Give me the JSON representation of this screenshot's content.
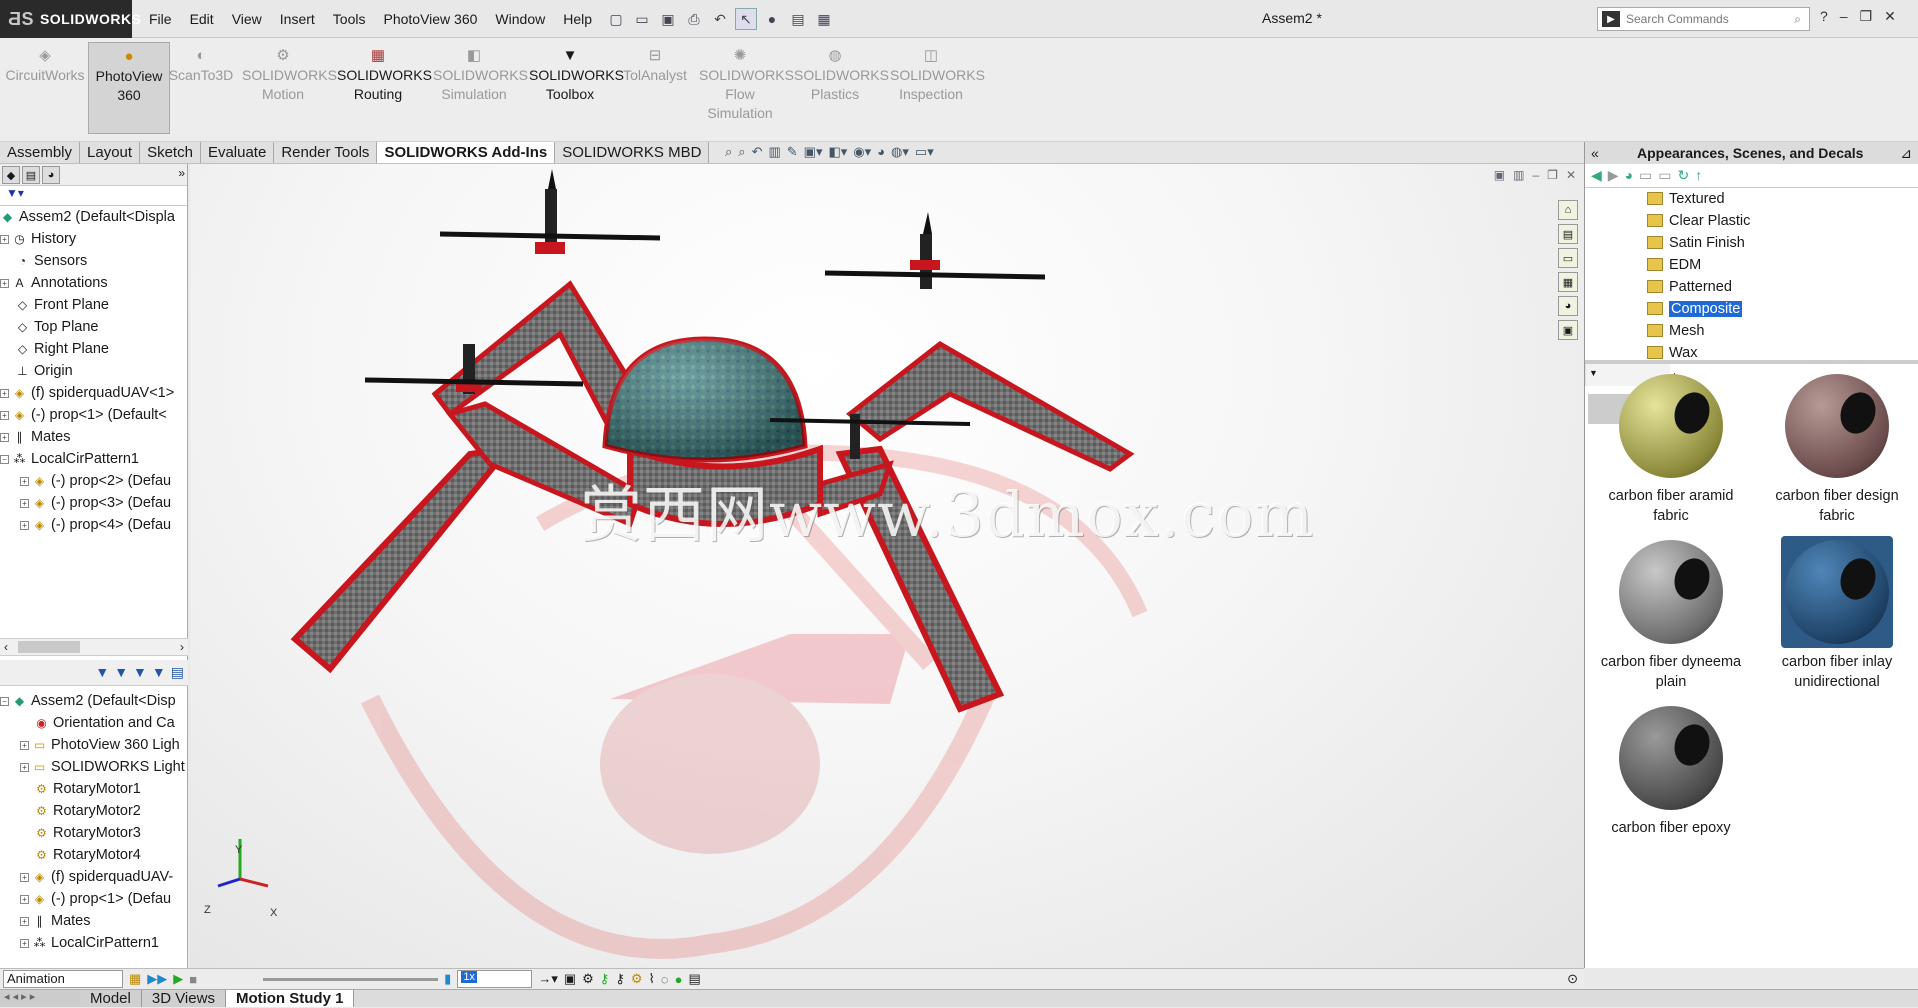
{
  "app": {
    "brand": "SOLIDWORKS",
    "document_title": "Assem2 *"
  },
  "menu": [
    "File",
    "Edit",
    "View",
    "Insert",
    "Tools",
    "PhotoView 360",
    "Window",
    "Help"
  ],
  "search": {
    "placeholder": "Search Commands"
  },
  "commands": [
    {
      "label1": "CircuitWorks",
      "label2": "",
      "label3": ""
    },
    {
      "label1": "PhotoView",
      "label2": "360",
      "label3": ""
    },
    {
      "label1": "ScanTo3D",
      "label2": "",
      "label3": ""
    },
    {
      "label1": "SOLIDWORKS",
      "label2": "Motion",
      "label3": ""
    },
    {
      "label1": "SOLIDWORKS",
      "label2": "Routing",
      "label3": ""
    },
    {
      "label1": "SOLIDWORKS",
      "label2": "Simulation",
      "label3": ""
    },
    {
      "label1": "SOLIDWORKS",
      "label2": "Toolbox",
      "label3": ""
    },
    {
      "label1": "TolAnalyst",
      "label2": "",
      "label3": ""
    },
    {
      "label1": "SOLIDWORKS",
      "label2": "Flow",
      "label3": "Simulation"
    },
    {
      "label1": "SOLIDWORKS",
      "label2": "Plastics",
      "label3": ""
    },
    {
      "label1": "SOLIDWORKS",
      "label2": "Inspection",
      "label3": ""
    }
  ],
  "cm_tabs": [
    "Assembly",
    "Layout",
    "Sketch",
    "Evaluate",
    "Render Tools",
    "SOLIDWORKS Add-Ins",
    "SOLIDWORKS MBD"
  ],
  "feature_tree": [
    "Assem2  (Default<Displa",
    "History",
    "Sensors",
    "Annotations",
    "Front Plane",
    "Top Plane",
    "Right Plane",
    "Origin",
    "(f) spiderquadUAV<1>",
    "(-) prop<1> (Default<",
    "Mates",
    "LocalCirPattern1",
    "(-) prop<2> (Defau",
    "(-) prop<3> (Defau",
    "(-) prop<4> (Defau"
  ],
  "motion_tree": [
    "Assem2  (Default<Disp",
    "Orientation and Ca",
    "PhotoView 360 Ligh",
    "SOLIDWORKS Light",
    "RotaryMotor1",
    "RotaryMotor2",
    "RotaryMotor3",
    "RotaryMotor4",
    "(f) spiderquadUAV-",
    "(-) prop<1> (Defau",
    "Mates",
    "LocalCirPattern1"
  ],
  "viewport": {
    "watermark": "赏西网www.3dmox.com",
    "triad_y": "Y",
    "triad_x": "X",
    "triad_z": "Z"
  },
  "task_pane": {
    "title": "Appearances, Scenes, and Decals",
    "folders": [
      "Textured",
      "Clear Plastic",
      "Satin Finish",
      "EDM",
      "Patterned",
      "Composite",
      "Mesh",
      "Wax"
    ],
    "selected_folder": "Composite",
    "swatches": [
      {
        "line1": "carbon fiber aramid",
        "line2": "fabric"
      },
      {
        "line1": "carbon fiber design",
        "line2": "fabric"
      },
      {
        "line1": "carbon fiber dyneema",
        "line2": "plain"
      },
      {
        "line1": "carbon fiber inlay",
        "line2": "unidirectional"
      },
      {
        "line1": "carbon fiber epoxy",
        "line2": ""
      }
    ]
  },
  "animation": {
    "mode": "Animation",
    "speed": "1x"
  },
  "bottom_tabs": [
    "Model",
    "3D Views",
    "Motion Study 1"
  ],
  "colors": {
    "accent_red": "#c8161e",
    "selection_blue": "#1f6ad6",
    "frame_gray": "#6a6a6a"
  }
}
